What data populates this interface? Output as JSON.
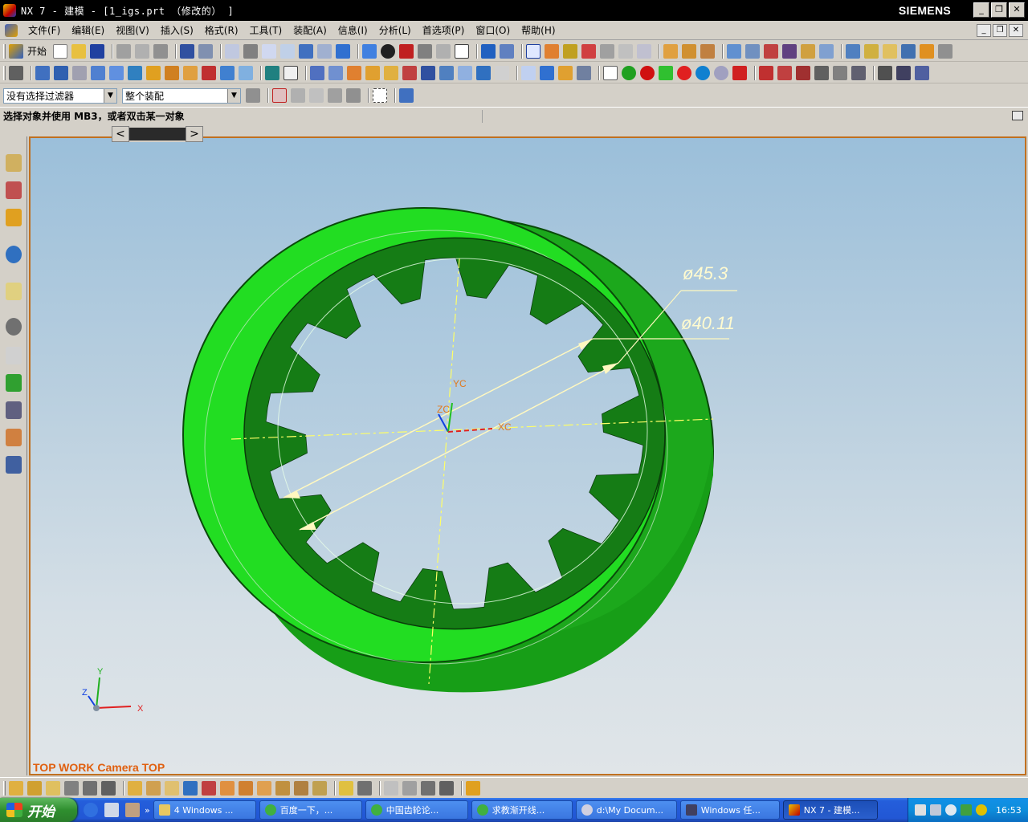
{
  "window": {
    "title": "NX 7 - 建模 - [1_igs.prt （修改的） ]",
    "brand": "SIEMENS"
  },
  "menubar": {
    "items": [
      "文件(F)",
      "编辑(E)",
      "视图(V)",
      "插入(S)",
      "格式(R)",
      "工具(T)",
      "装配(A)",
      "信息(I)",
      "分析(L)",
      "首选项(P)",
      "窗口(O)",
      "帮助(H)"
    ]
  },
  "toolbar": {
    "start_label": "开始"
  },
  "selection": {
    "filter_value": "没有选择过滤器",
    "scope_value": "整个装配"
  },
  "cue": {
    "text": "选择对象并使用 MB3，或者双击某一对象"
  },
  "graphics": {
    "view_label": "TOP WORK Camera TOP",
    "dim_outer": "ø45.3",
    "dim_inner": "ø40.11",
    "axis_labels": {
      "xc": "XC",
      "yc": "YC",
      "zc": "ZC",
      "x": "X",
      "y": "Y",
      "z": "Z"
    },
    "part_color": "#22dd22"
  },
  "taskbar": {
    "start_label": "开始",
    "buttons": [
      "4 Windows ...",
      "百度一下，...",
      "中国齿轮论...",
      "求教渐开线...",
      "d:\\My Docum...",
      "Windows 任...",
      "NX 7 - 建模..."
    ],
    "clock": "16:53"
  }
}
